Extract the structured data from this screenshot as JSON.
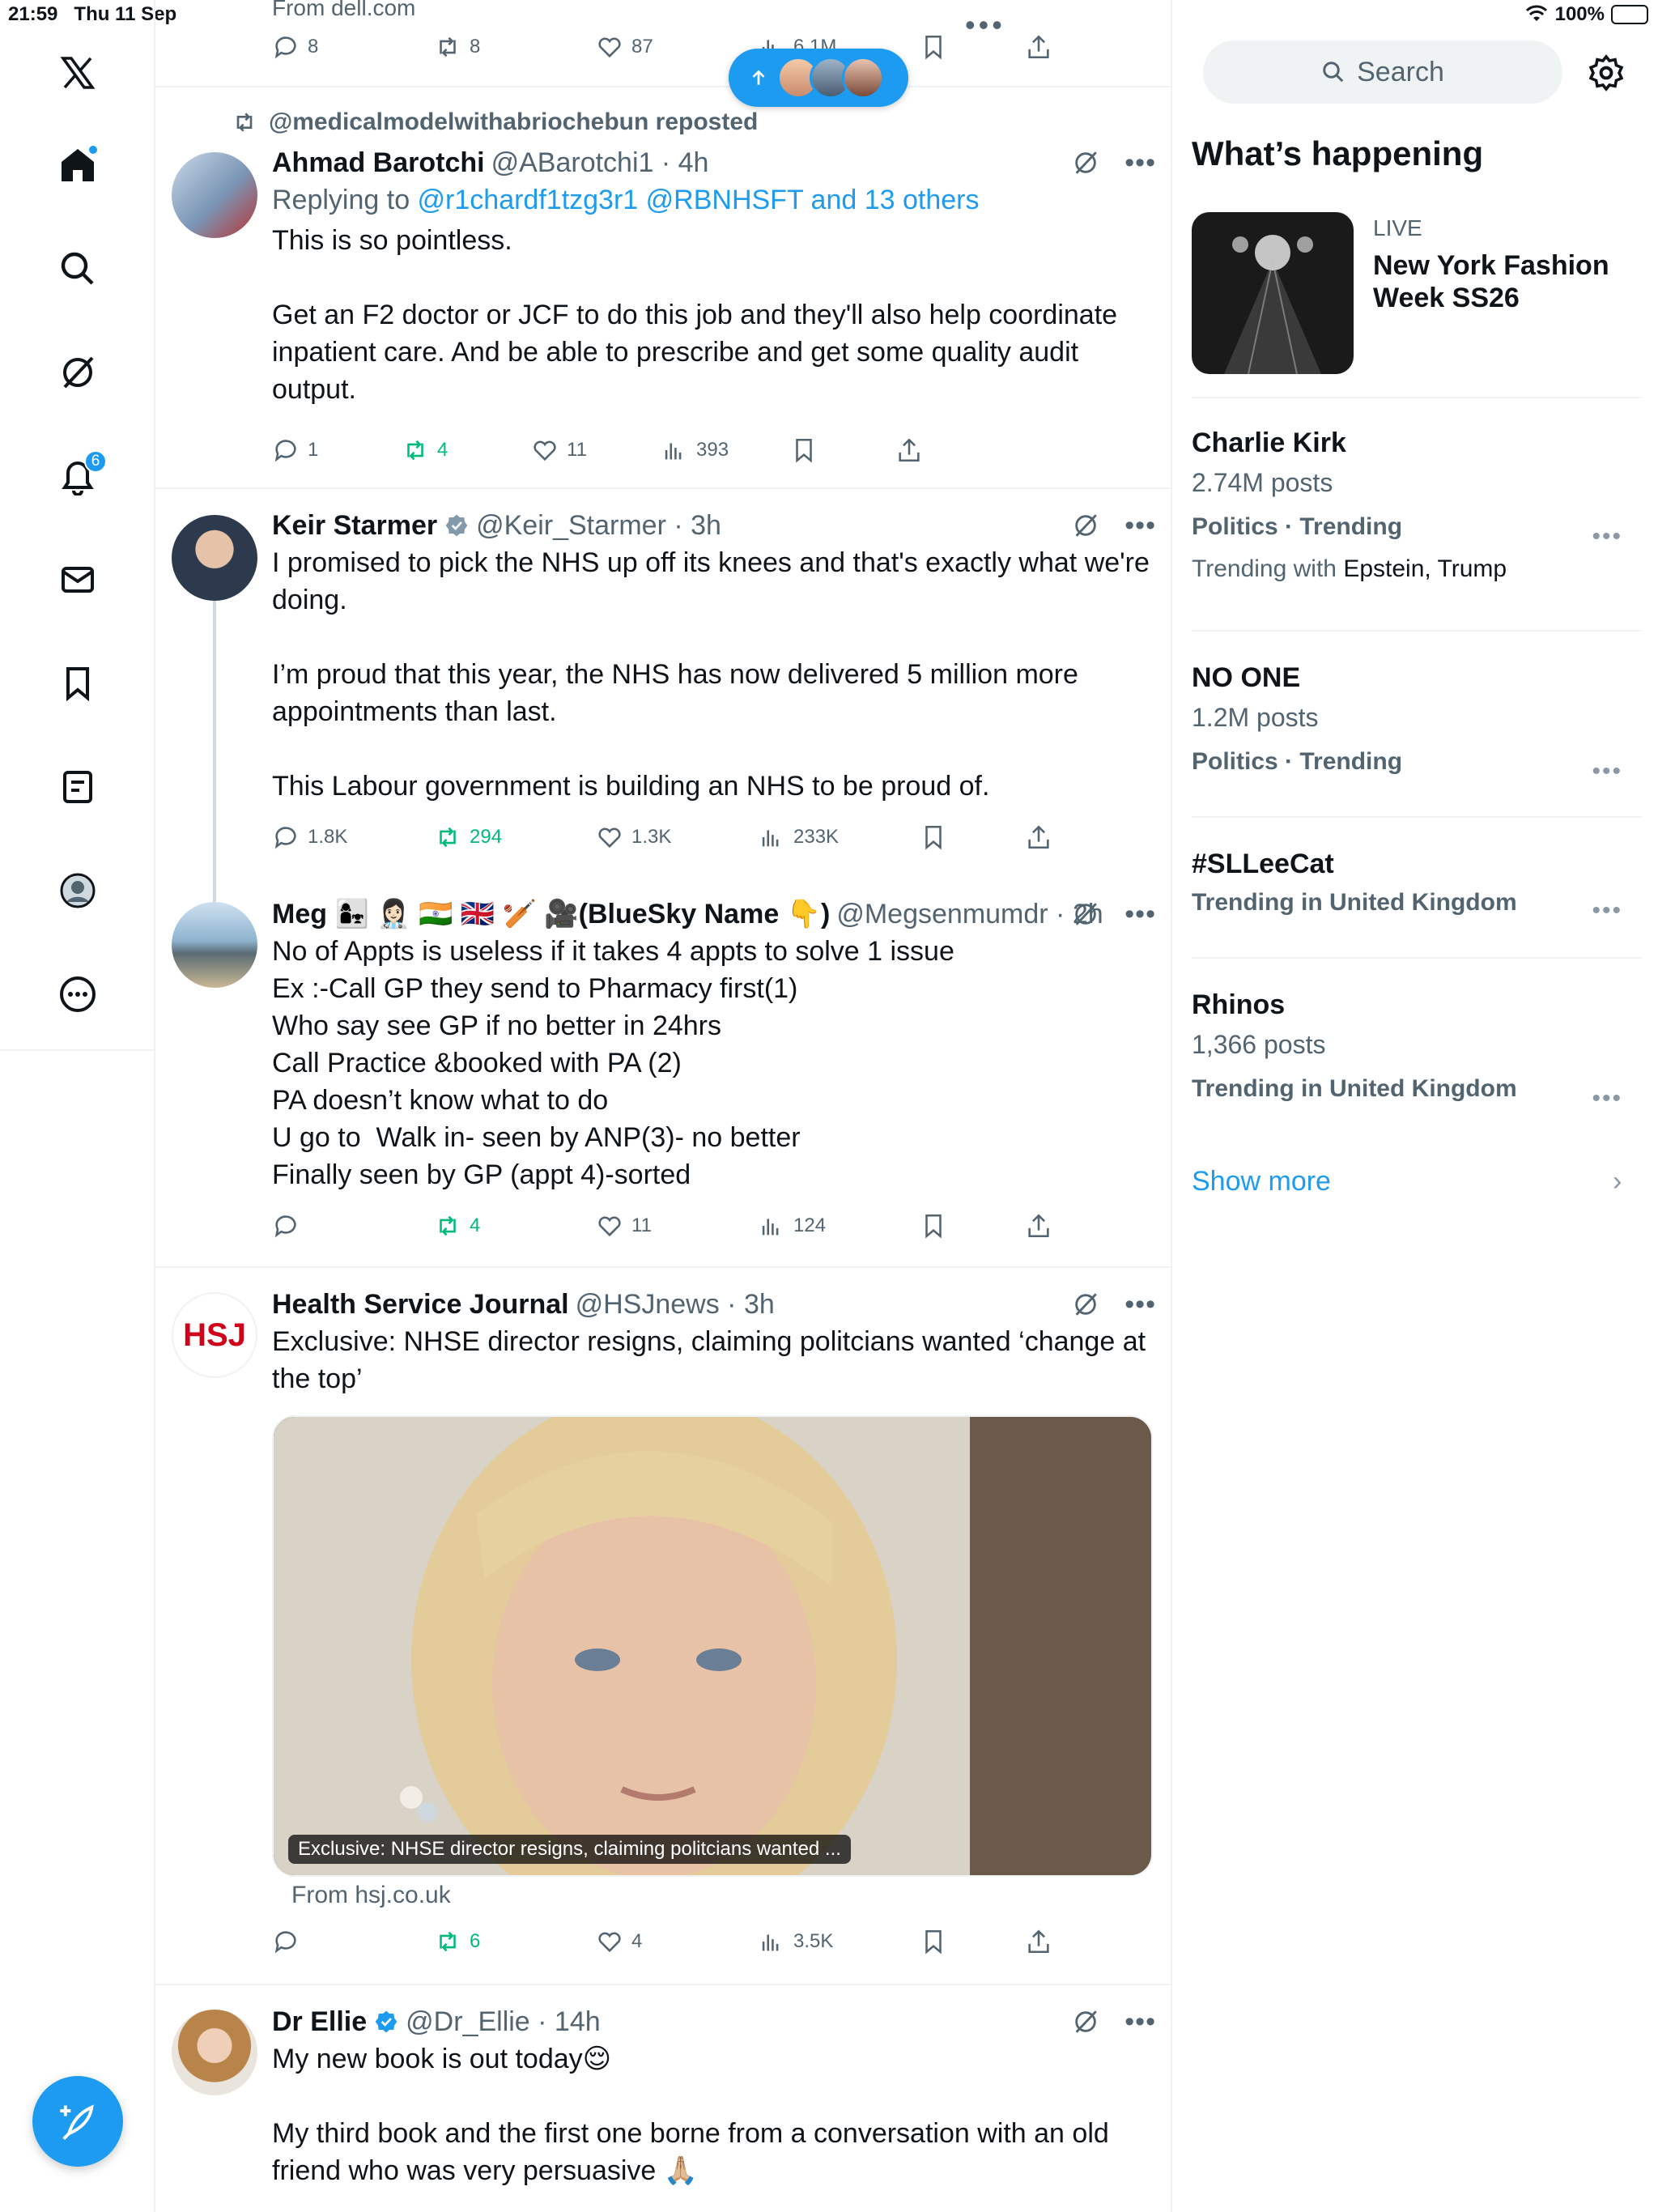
{
  "status": {
    "time": "21:59",
    "date": "Thu 11 Sep",
    "battery": "100%"
  },
  "colors": {
    "accent": "#1d9bf0",
    "repost_green": "#00ba7c",
    "muted": "#536471"
  },
  "rail": {
    "items": [
      {
        "name": "x-logo-icon"
      },
      {
        "name": "home-icon"
      },
      {
        "name": "search-icon"
      },
      {
        "name": "grok-icon"
      },
      {
        "name": "notifications-icon",
        "badge": "6"
      },
      {
        "name": "messages-icon"
      },
      {
        "name": "bookmarks-icon"
      },
      {
        "name": "lists-icon"
      },
      {
        "name": "profile-icon"
      },
      {
        "name": "more-icon"
      }
    ]
  },
  "feed": {
    "top_partial": {
      "from": "From dell.com",
      "replies": "8",
      "reposts": "8",
      "likes": "87",
      "views": "6.1M"
    },
    "tweets": [
      {
        "repost_by": "@medicalmodelwithabriochebun reposted",
        "name": "Ahmad Barotchi",
        "handle": "@ABarotchi1 · 4h",
        "replying_prefix": "Replying to ",
        "replying_to": "@r1chardf1tzg3r1 @RBNHSFT and 13 others",
        "body": "This is so pointless.\n\nGet an F2 doctor or JCF to do this job and they'll also help coordinate inpatient care. And be able to prescribe and get some quality audit output.",
        "replies": "1",
        "reposts": "4",
        "likes": "11",
        "views": "393"
      },
      {
        "name": "Keir Starmer",
        "handle": "@Keir_Starmer · 3h",
        "body": "I promised to pick the NHS up off its knees and that's exactly what we're doing.\n\nI’m proud that this year, the NHS has now delivered 5 million more appointments than last.\n\nThis Labour government is building an NHS to be proud of.",
        "replies": "1.8K",
        "reposts": "294",
        "likes": "1.3K",
        "views": "233K"
      },
      {
        "name": "Meg 👩‍👧 👩🏻‍⚕️ 🇮🇳 🇬🇧 🏏 🎥(BlueSky Name 👇)",
        "handle": "@Megsenmumdr · 2h",
        "body": "No of Appts is useless if it takes 4 appts to solve 1 issue\nEx :-Call GP they send to Pharmacy first(1)\nWho say see GP if no better in 24hrs\nCall Practice &booked with PA (2)\nPA doesn’t know what to do\nU go to  Walk in- seen by ANP(3)- no better\nFinally seen by GP (appt 4)-sorted",
        "replies": "",
        "reposts": "4",
        "likes": "11",
        "views": "124"
      },
      {
        "name": "Health Service Journal",
        "handle": "@HSJnews · 3h",
        "avatar_text": "HSJ",
        "body": "Exclusive: NHSE director resigns, claiming politcians wanted ‘change at the top’",
        "media_caption": "Exclusive: NHSE director resigns, claiming politcians wanted ...",
        "from": "From hsj.co.uk",
        "replies": "",
        "reposts": "6",
        "likes": "4",
        "views": "3.5K"
      },
      {
        "name": "Dr Ellie",
        "handle": "@Dr_Ellie · 14h",
        "body": "My new book is out today😌\n\nMy third book and the first one borne from a conversation with an old friend who was very persuasive 🙏🏼"
      }
    ]
  },
  "sidebar": {
    "search_placeholder": "Search",
    "section_title": "What’s happening",
    "live": {
      "label": "LIVE",
      "title": "New York Fashion Week SS26"
    },
    "trends": [
      {
        "title": "Charlie Kirk",
        "posts": "2.74M posts",
        "category": "Politics · Trending",
        "with_prefix": "Trending with ",
        "with": "Epstein, Trump"
      },
      {
        "title": "NO ONE",
        "posts": "1.2M posts",
        "category": "Politics · Trending"
      },
      {
        "title": "#SLLeeCat",
        "category": "Trending in United Kingdom"
      },
      {
        "title": "Rhinos",
        "posts": "1,366 posts",
        "category": "Trending in United Kingdom"
      }
    ],
    "show_more": "Show more"
  }
}
